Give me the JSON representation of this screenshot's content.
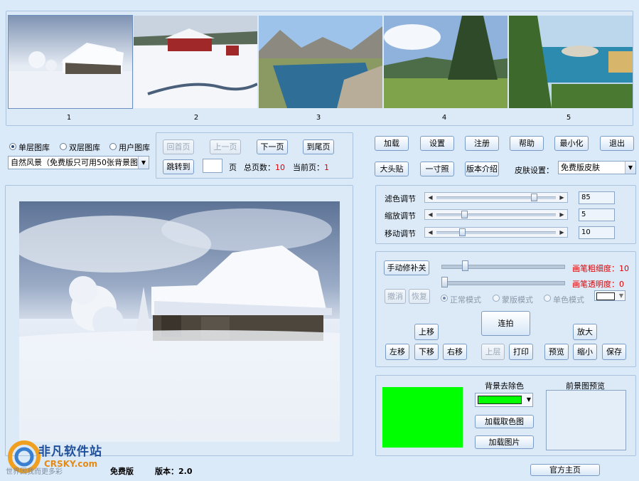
{
  "thumbnails": [
    {
      "label": "1",
      "scene": "snow-cottage"
    },
    {
      "label": "2",
      "scene": "red-barn-snow"
    },
    {
      "label": "3",
      "scene": "mountain-river"
    },
    {
      "label": "4",
      "scene": "forest-meadow"
    },
    {
      "label": "5",
      "scene": "coastal-island"
    }
  ],
  "library": {
    "radio_single": "单层图库",
    "radio_double": "双层图库",
    "radio_user": "用户图库",
    "selected": "single",
    "category": "自然风景（免费版只可用50张背景图）"
  },
  "paging": {
    "first": "回首页",
    "prev": "上一页",
    "next": "下一页",
    "last": "到尾页",
    "jump": "跳转到",
    "page_unit": "页",
    "total_label": "总页数：",
    "total_value": "10",
    "current_label": "当前页：",
    "current_value": "1"
  },
  "toolbar": {
    "load": "加载",
    "settings": "设置",
    "register": "注册",
    "help": "帮助",
    "minimize": "最小化",
    "exit": "退出",
    "big_head": "大头贴",
    "one_inch": "一寸照",
    "about_version": "版本介绍",
    "skin_label": "皮肤设置：",
    "skin_value": "免费版皮肤"
  },
  "adjust": {
    "filter_label": "滤色调节",
    "filter_value": "85",
    "zoom_label": "缩放调节",
    "zoom_value": "5",
    "move_label": "移动调节",
    "move_value": "10"
  },
  "fix": {
    "manual_fix": "手动修补关",
    "brush_size_label": "画笔粗细度：",
    "brush_size_value": "10",
    "brush_alpha_label": "画笔透明度：",
    "brush_alpha_value": "0",
    "undo": "撤消",
    "redo": "恢复",
    "mode_normal": "正常模式",
    "mode_mask": "蒙版模式",
    "mode_mono": "单色模式",
    "burst": "连拍",
    "up": "上移",
    "left": "左移",
    "down": "下移",
    "right": "右移",
    "upper_layer": "上层",
    "print": "打印",
    "preview": "预览",
    "zoom_in": "放大",
    "zoom_out": "缩小",
    "save": "保存"
  },
  "background": {
    "title": "背景去除色",
    "color": "#00ff00",
    "load_color_image": "加载取色图",
    "load_image": "加载图片",
    "foreground_preview": "前景图预览"
  },
  "footer": {
    "edition": "免费版",
    "version_label": "版本：",
    "version_value": "2.0",
    "official_home": "官方主页",
    "watermark_title": "非凡软件站",
    "watermark_sub": "CRSKY.com",
    "watermark_slogan": "世界因我而更多彩"
  }
}
